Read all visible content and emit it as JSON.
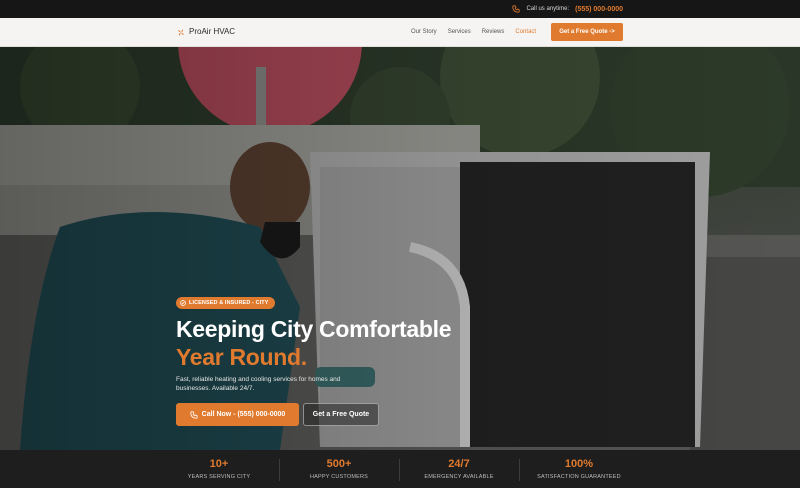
{
  "topbar": {
    "label": "Call us anytime:",
    "phone": "(555) 000-0000",
    "icon": "phone-icon"
  },
  "nav": {
    "brand": "ProAir HVAC",
    "logo_icon": "fan-icon",
    "items": [
      {
        "label": "Our Story",
        "active": false
      },
      {
        "label": "Services",
        "active": false
      },
      {
        "label": "Reviews",
        "active": false
      },
      {
        "label": "Contact",
        "active": true
      }
    ],
    "cta": "Get a Free Quote ->"
  },
  "hero": {
    "badge": "LICENSED & INSURED - CITY",
    "badge_icon": "shield-icon",
    "title_line1": "Keeping City Comfortable",
    "title_line2": "Year Round.",
    "subtitle": "Fast, reliable heating and cooling services for homes and businesses. Available 24/7.",
    "call_button": "Call Now - (555) 000-0000",
    "quote_button": "Get a Free Quote"
  },
  "stats": [
    {
      "value": "10+",
      "label": "YEARS SERVING CITY"
    },
    {
      "value": "500+",
      "label": "HAPPY CUSTOMERS"
    },
    {
      "value": "24/7",
      "label": "EMERGENCY AVAILABLE"
    },
    {
      "value": "100%",
      "label": "SATISFACTION GUARANTEED"
    }
  ],
  "colors": {
    "accent": "#e07a2e",
    "dark": "#1e1e1e",
    "nav_bg": "#f6f4f2"
  }
}
